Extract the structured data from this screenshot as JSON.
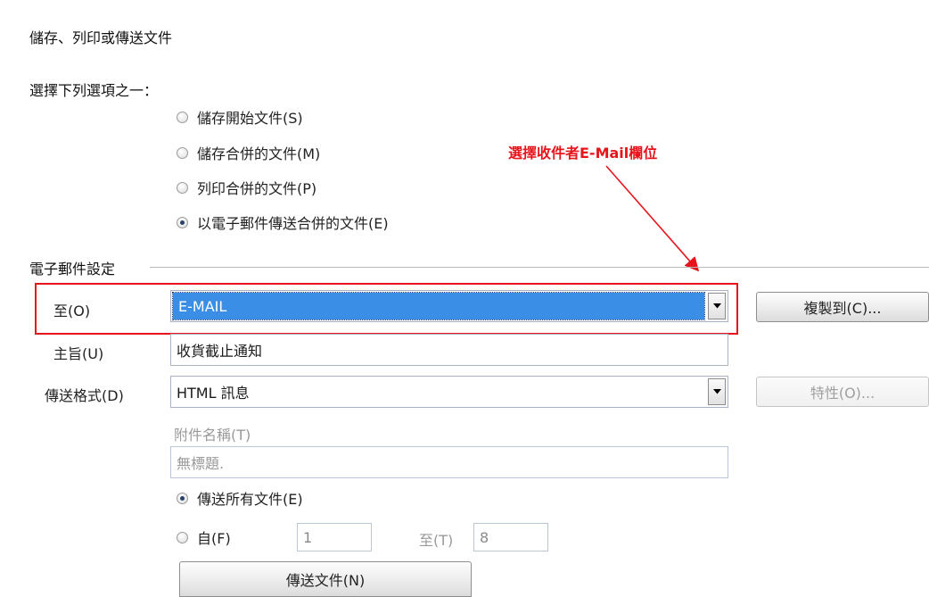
{
  "section": {
    "title": "儲存、列印或傳送文件",
    "prompt": "選擇下列選項之一："
  },
  "options": [
    {
      "label": "儲存開始文件(S)",
      "checked": false
    },
    {
      "label": "儲存合併的文件(M)",
      "checked": false
    },
    {
      "label": "列印合併的文件(P)",
      "checked": false
    },
    {
      "label": "以電子郵件傳送合併的文件(E)",
      "checked": true
    }
  ],
  "annotation": {
    "text": "選擇收件者E-Mail欄位",
    "color": "#e8141c"
  },
  "email_settings": {
    "group_label": "電子郵件設定",
    "to_label": "至(O)",
    "to_value": "E-MAIL",
    "copy_to_button": "複製到(C)...",
    "subject_label": "主旨(U)",
    "subject_value": "收貨截止通知",
    "format_label": "傳送格式(D)",
    "format_value": "HTML 訊息",
    "properties_button": "特性(O)...",
    "attachment_label": "附件名稱(T)",
    "attachment_value": "無標題.",
    "send_all_label": "傳送所有文件(E)",
    "from_label": "自(F)",
    "from_value": "1",
    "to_range_label": "至(T)",
    "to_range_value": "8",
    "send_button": "傳送文件(N)"
  },
  "colors": {
    "selection": "#3a8ee6",
    "annotation_red": "#e8141c"
  }
}
